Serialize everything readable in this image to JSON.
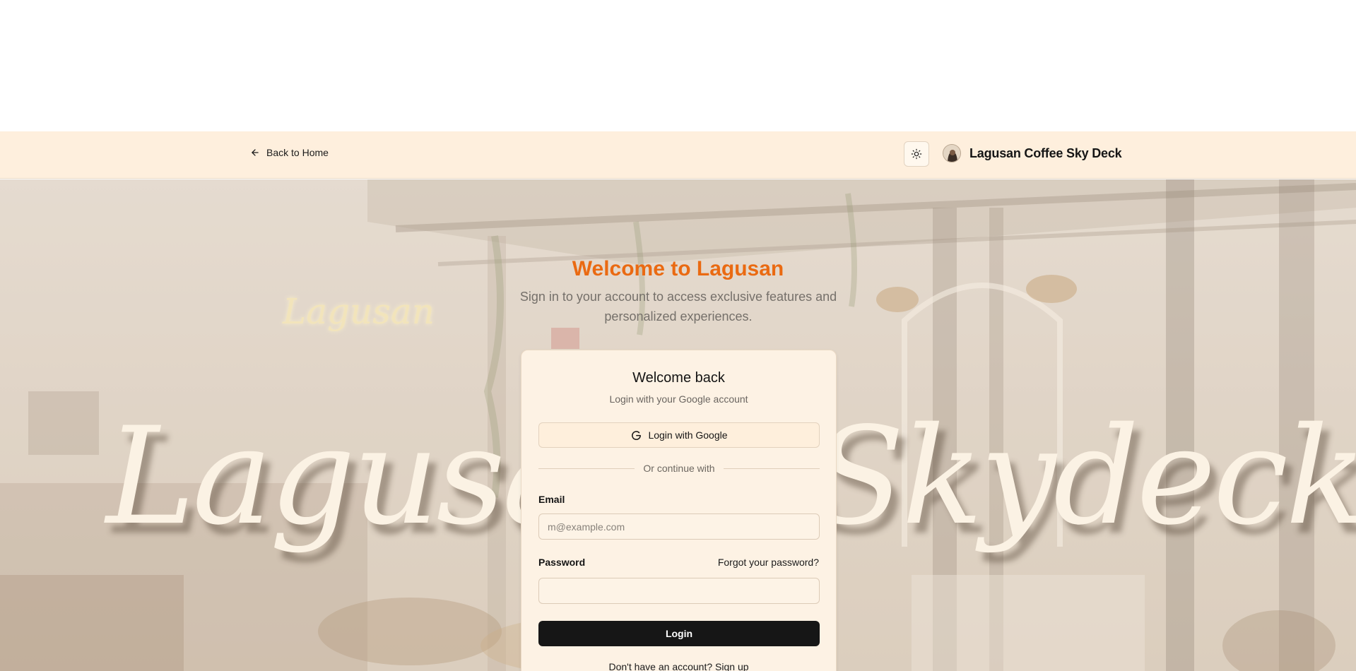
{
  "header": {
    "back_label": "Back to Home",
    "brand_name": "Lagusan Coffee Sky Deck"
  },
  "hero": {
    "heading": "Welcome to Lagusan",
    "subheading": "Sign in to your account to access exclusive features and personalized experiences.",
    "script_left": "Lagusan",
    "script_right": "Skydeck",
    "neon_sign": "Lagusan"
  },
  "login_card": {
    "title": "Welcome back",
    "subtitle": "Login with your Google account",
    "google_button": "Login with Google",
    "divider_text": "Or continue with",
    "email_label": "Email",
    "email_placeholder": "m@example.com",
    "email_value": "",
    "password_label": "Password",
    "forgot_link": "Forgot your password?",
    "password_value": "",
    "login_button": "Login",
    "signup_prompt": "Don't have an account?",
    "signup_link": "Sign up"
  },
  "colors": {
    "accent": "#ea6a12",
    "header_bg": "#feefdd",
    "card_bg": "#fdf2e4",
    "button_dark": "#161616"
  },
  "icons": [
    "arrow-left-icon",
    "sun-icon",
    "brand-logo",
    "google-icon"
  ]
}
